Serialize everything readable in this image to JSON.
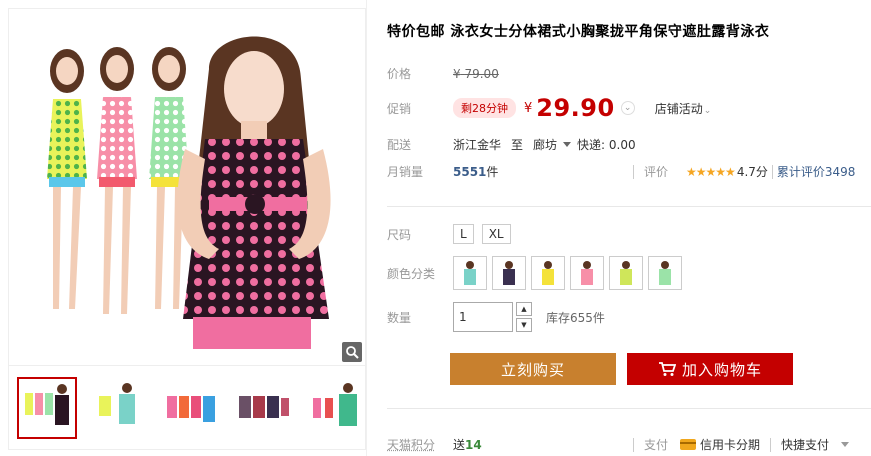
{
  "product": {
    "title": "特价包邮 泳衣女士分体裙式小胸聚拢平角保守遮肚露背泳衣"
  },
  "price": {
    "label": "价格",
    "currency": "¥",
    "original": "79.00"
  },
  "promo": {
    "label": "促销",
    "timer": "剩28分钟",
    "currency": "¥",
    "price": "29.90",
    "chevron": "⌄",
    "store_activity": "店铺活动"
  },
  "delivery": {
    "label": "配送",
    "from": "浙江金华",
    "to_word": "至",
    "to": "廊坊",
    "express": "快递: 0.00"
  },
  "sales": {
    "label": "月销量",
    "count": "5551",
    "unit": "件",
    "rating_label": "评价",
    "stars": "★★★★★",
    "score": "4.7分",
    "total_reviews": "累计评价3498"
  },
  "size": {
    "label": "尺码",
    "options": [
      "L",
      "XL"
    ]
  },
  "color": {
    "label": "颜色分类"
  },
  "quantity": {
    "label": "数量",
    "value": "1",
    "stock": "库存655件",
    "up": "▲",
    "down": "▼"
  },
  "actions": {
    "buy": "立刻购买",
    "cart": "加入购物车"
  },
  "bottom": {
    "points_label": "天猫积分",
    "points_prefix": "送",
    "points_value": "14",
    "pay_label": "支付",
    "credit": "信用卡分期",
    "quick_pay": "快捷支付"
  },
  "icons": {
    "zoom": "magnifier-icon",
    "cart": "cart-icon",
    "card": "credit-card-icon"
  },
  "colors": {
    "accent_red": "#c40000",
    "buy_orange": "#c8802e",
    "star": "#f5a623"
  }
}
